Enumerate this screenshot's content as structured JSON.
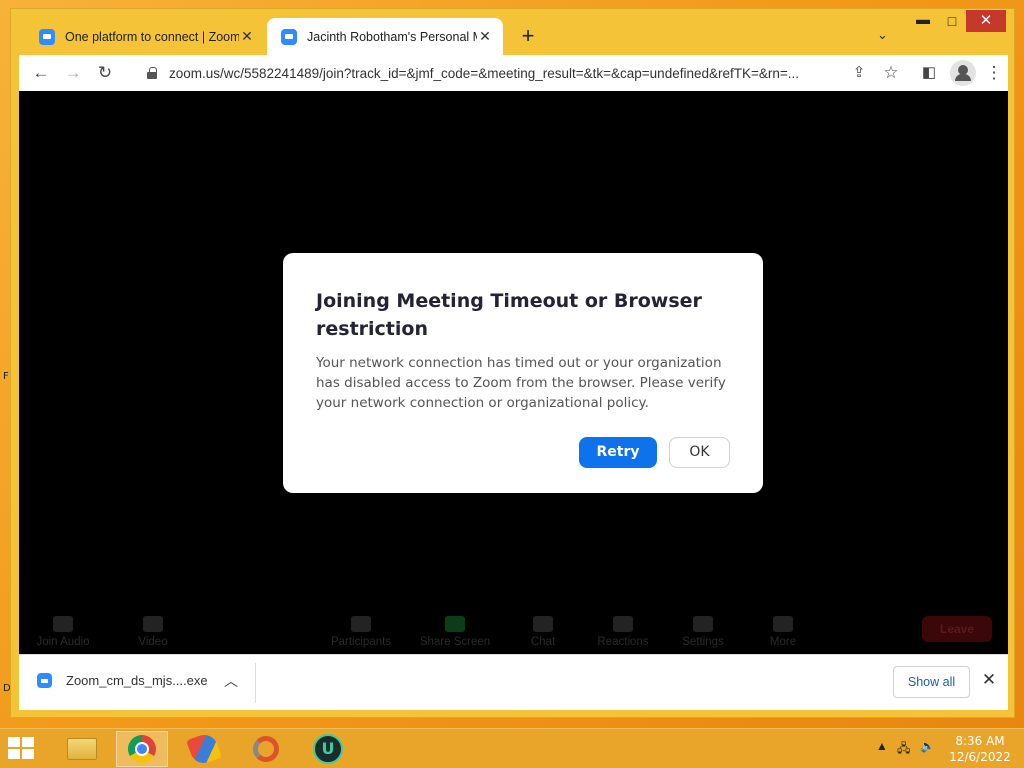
{
  "browser": {
    "tabs": [
      {
        "title": "One platform to connect | Zoom",
        "active": false
      },
      {
        "title": "Jacinth Robotham's Personal Me",
        "active": true
      }
    ],
    "new_tab_icon": "plus-icon",
    "address": "zoom.us/wc/5582241489/join?track_id=&jmf_code=&meeting_result=&tk=&cap=undefined&refTK=&rn=...",
    "window_controls": {
      "minimize": "▬",
      "maximize": "□",
      "close": "✕"
    }
  },
  "meeting_controls": {
    "items": [
      "Join Audio",
      "Video",
      "Participants",
      "Share Screen",
      "Chat",
      "Reactions",
      "Settings",
      "More"
    ],
    "leave_label": "Leave"
  },
  "dialog": {
    "title": "Joining Meeting Timeout or Browser restriction",
    "message": "Your network connection has timed out or your organization has disabled access to Zoom from the browser. Please verify your network connection or organizational policy.",
    "retry_label": "Retry",
    "ok_label": "OK",
    "accent_color": "#0e72ed"
  },
  "downloads": {
    "file_name": "Zoom_cm_ds_mjs....exe",
    "show_all_label": "Show all"
  },
  "taskbar": {
    "apps": [
      "file-explorer-icon",
      "chrome-icon",
      "ccleaner-icon",
      "app-ring-icon",
      "u-app-icon"
    ],
    "time": "8:36 AM",
    "date": "12/6/2022"
  },
  "desktop": {
    "edge_letters": [
      "F",
      "D"
    ]
  }
}
